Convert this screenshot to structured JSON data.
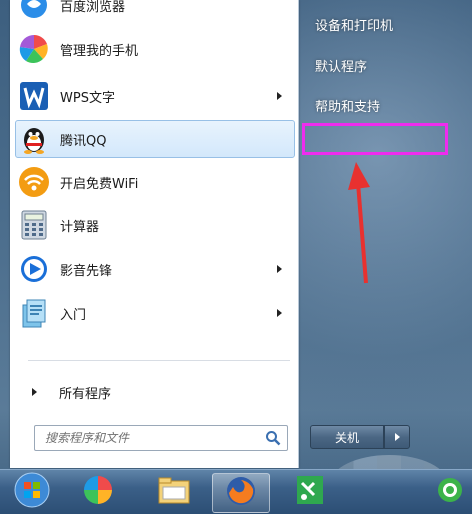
{
  "programs": [
    {
      "label": "百度浏览器",
      "icon": "baidu-browser-icon",
      "has_submenu": false
    },
    {
      "label": "管理我的手机",
      "icon": "phone-manager-icon",
      "has_submenu": false
    },
    {
      "label": "WPS文字",
      "icon": "wps-writer-icon",
      "has_submenu": true
    },
    {
      "label": "腾讯QQ",
      "icon": "qq-penguin-icon",
      "has_submenu": false
    },
    {
      "label": "开启免费WiFi",
      "icon": "wifi-icon",
      "has_submenu": false
    },
    {
      "label": "计算器",
      "icon": "calculator-icon",
      "has_submenu": false
    },
    {
      "label": "影音先锋",
      "icon": "media-player-icon",
      "has_submenu": true
    },
    {
      "label": "入门",
      "icon": "getting-started-icon",
      "has_submenu": true
    }
  ],
  "all_programs_label": "所有程序",
  "search": {
    "placeholder": "搜索程序和文件"
  },
  "right_panel": {
    "devices_printers": "设备和打印机",
    "default_programs": "默认程序",
    "help_support": "帮助和支持"
  },
  "shutdown": {
    "label": "关机"
  },
  "colors": {
    "highlight_box": "#ee2cee",
    "arrow": "#e8312f",
    "selected_item": "#d3e8fb"
  },
  "taskbar": {
    "items": [
      "start-orb-icon",
      "pinwheel-app-icon",
      "file-explorer-icon",
      "firefox-icon",
      "green-app-icon",
      "browser-icon"
    ]
  }
}
